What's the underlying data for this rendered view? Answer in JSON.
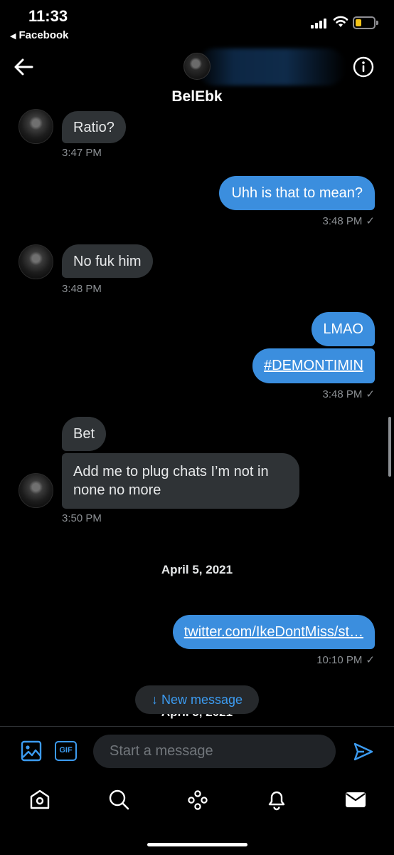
{
  "status_bar": {
    "time": "11:33",
    "back_app": "Facebook"
  },
  "header": {
    "name": "BelEbk"
  },
  "messages": [
    {
      "direction": "in",
      "text": "Ratio?",
      "time": "3:47 PM"
    },
    {
      "direction": "out",
      "text": "Uhh is that to mean?",
      "time": "3:48 PM"
    },
    {
      "direction": "in",
      "text": "No fuk him",
      "time": "3:48 PM"
    },
    {
      "direction": "out",
      "text": "LMAO"
    },
    {
      "direction": "out",
      "text": "#DEMONTIMIN",
      "time": "3:48 PM"
    },
    {
      "direction": "in",
      "text": "Bet"
    },
    {
      "direction": "in",
      "text": "Add me to plug chats I’m not in",
      "text2": "none no more",
      "time": "3:50 PM"
    },
    {
      "direction": "out",
      "text": "twitter.com/IkeDontMiss/st…",
      "time": "10:10 PM"
    }
  ],
  "date_separator": "April 5, 2021",
  "ghost_date": "April 5, 2021",
  "new_message_pill": "New message",
  "new_message_arrow": "↓",
  "composer": {
    "gif_label": "GIF",
    "placeholder": "Start a message"
  },
  "read_check": "✓",
  "colors": {
    "background": "#000000",
    "incoming_bubble": "#2f3336",
    "outgoing_bubble": "#3b8ede",
    "accent": "#3c9bf0",
    "timestamp": "#8b8f93"
  },
  "icons": {
    "back": "arrow-left-icon",
    "info": "info-icon",
    "image": "image-icon",
    "gif": "gif-icon",
    "send": "send-icon",
    "tabs": [
      "home-icon",
      "search-icon",
      "spaces-icon",
      "notifications-icon",
      "messages-icon"
    ]
  }
}
